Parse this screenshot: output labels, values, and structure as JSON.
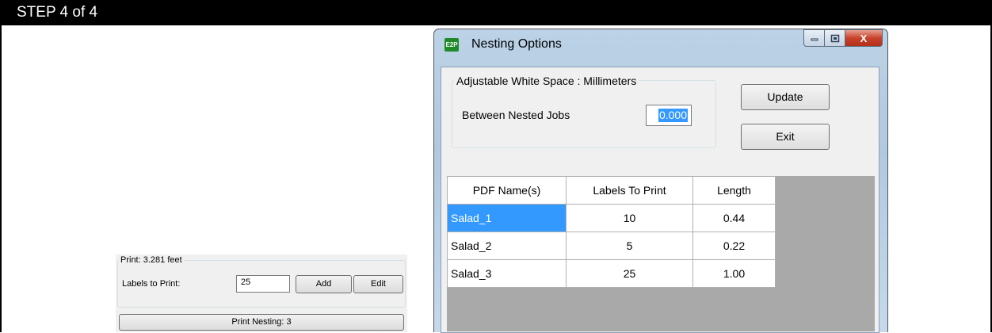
{
  "step_bar": {
    "text": "STEP 4 of 4"
  },
  "print_panel": {
    "group_title": "Print: 3.281 feet",
    "labels_label": "Labels to Print:",
    "labels_value": "25",
    "add_label": "Add",
    "edit_label": "Edit",
    "print_button_label": "Print Nesting: 3"
  },
  "window": {
    "icon_text": "E2P",
    "title": "Nesting Options",
    "minimize_icon": "minimize-icon",
    "maximize_icon": "maximize-icon",
    "close_icon": "close-icon",
    "close_glyph": "X",
    "group_title": "Adjustable White Space : Millimeters",
    "between_label": "Between Nested Jobs",
    "between_value": "0.000",
    "update_label": "Update",
    "exit_label": "Exit",
    "grid": {
      "headers": [
        "PDF Name(s)",
        "Labels To Print",
        "Length"
      ],
      "rows": [
        {
          "name": "Salad_1",
          "labels": "10",
          "length": "0.44"
        },
        {
          "name": "Salad_2",
          "labels": "5",
          "length": "0.22"
        },
        {
          "name": "Salad_3",
          "labels": "25",
          "length": "1.00"
        }
      ]
    }
  }
}
